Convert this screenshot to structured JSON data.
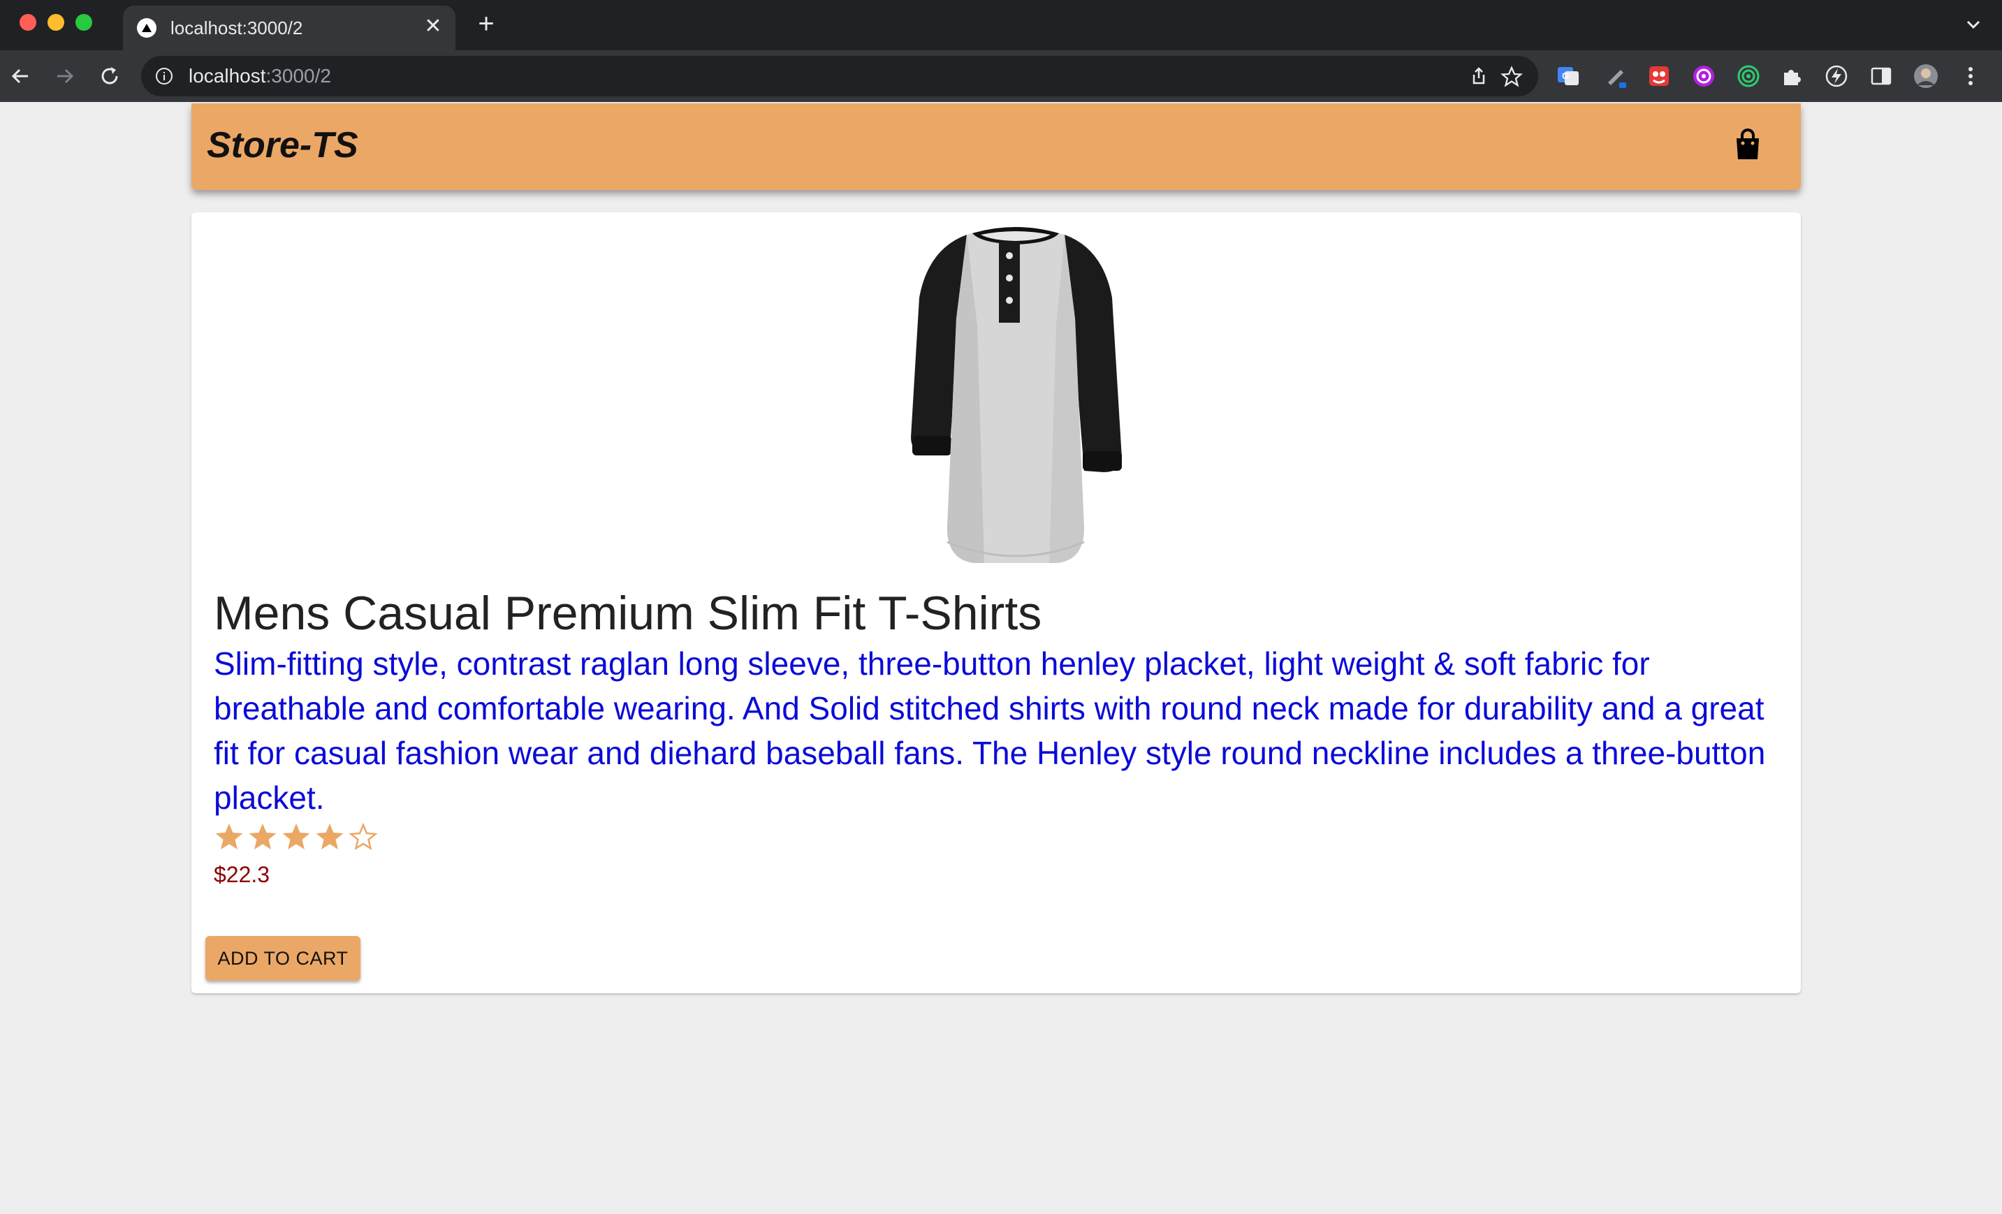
{
  "browser": {
    "tab_title": "localhost:3000/2",
    "url_host": "localhost",
    "url_path": ":3000/2",
    "tab_close": "✕",
    "new_tab": "+"
  },
  "header": {
    "brand": "Store-TS",
    "cart_icon": "shopping-bag-icon",
    "background": "#eba766"
  },
  "product": {
    "title": "Mens Casual Premium Slim Fit T-Shirts",
    "description": "Slim-fitting style, contrast raglan long sleeve, three-button henley placket, light weight & soft fabric for breathable and comfortable wearing. And Solid stitched shirts with round neck made for durability and a great fit for casual fashion wear and diehard baseball fans. The Henley style round neckline includes a three-button placket.",
    "rating": 4,
    "rating_max": 5,
    "price": "$22.3",
    "add_to_cart_label": "ADD TO CART",
    "desc_color": "#0b0bd8",
    "price_color": "#8b0000"
  }
}
